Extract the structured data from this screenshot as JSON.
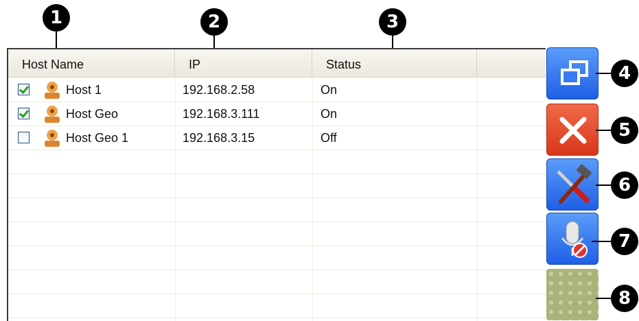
{
  "callouts": [
    "1",
    "2",
    "3",
    "4",
    "5",
    "6",
    "7",
    "8"
  ],
  "table": {
    "columns": [
      "Host Name",
      "IP",
      "Status"
    ],
    "rows": [
      {
        "checked": true,
        "name": "Host 1",
        "ip": "192.168.2.58",
        "status": "On"
      },
      {
        "checked": true,
        "name": "Host Geo",
        "ip": "192.168.3.111",
        "status": "On"
      },
      {
        "checked": false,
        "name": "Host Geo 1",
        "ip": "192.168.3.15",
        "status": "Off"
      }
    ]
  },
  "buttons": [
    {
      "name": "restore-window-button",
      "icon": "restore-window-icon",
      "color": "#2f6ff0"
    },
    {
      "name": "close-button",
      "icon": "close-icon",
      "color": "#e44a2a"
    },
    {
      "name": "tools-button",
      "icon": "tools-icon",
      "color": "#2f6ff0"
    },
    {
      "name": "microphone-mute-button",
      "icon": "microphone-mute-icon",
      "color": "#2f6ff0"
    },
    {
      "name": "blank-button",
      "icon": "",
      "color": "#aab37a"
    }
  ]
}
